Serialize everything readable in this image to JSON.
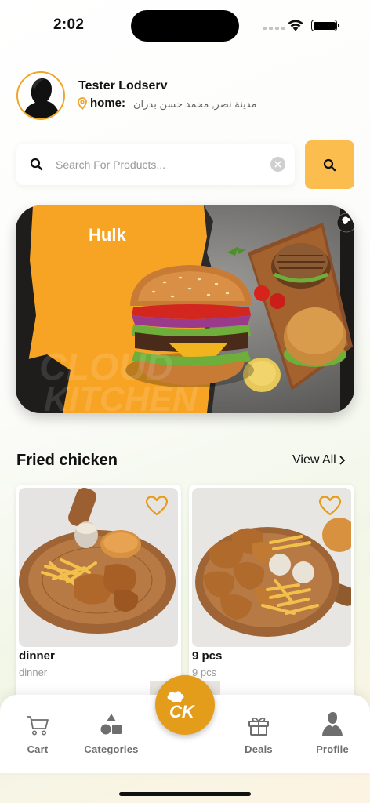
{
  "status_bar": {
    "time": "2:02"
  },
  "user": {
    "name": "Tester Lodserv",
    "address_label": "home:",
    "address_text": "مدينة نصر, محمد حسن بدران"
  },
  "search": {
    "placeholder": "Search For Products..."
  },
  "banner": {
    "title": "Hulk",
    "watermark_line1": "CLOUD",
    "watermark_line2": "KITCHEN"
  },
  "section": {
    "title": "Fried chicken",
    "view_all": "View All"
  },
  "products": [
    {
      "title": "dinner",
      "subtitle": "dinner"
    },
    {
      "title": "9 pcs",
      "subtitle": "9 pcs"
    }
  ],
  "nav": {
    "items": [
      {
        "label": "Cart",
        "icon": "cart-icon"
      },
      {
        "label": "Categories",
        "icon": "categories-icon"
      },
      {
        "label": "Deals",
        "icon": "gift-icon"
      },
      {
        "label": "Profile",
        "icon": "person-icon"
      }
    ],
    "center_logo_text": "CK"
  },
  "colors": {
    "accent": "#f0a52a",
    "search_button": "#fbbd4e",
    "center_button": "#e39d1a",
    "banner_orange": "#f7a425"
  }
}
